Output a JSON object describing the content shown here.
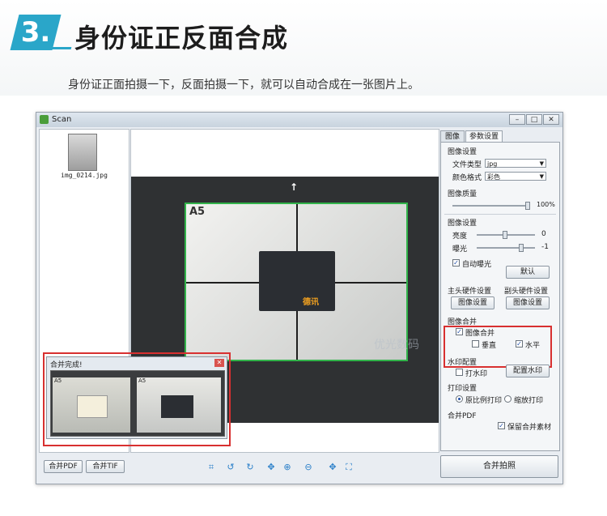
{
  "header": {
    "step_number": "3.",
    "title": "身份证正反面合成",
    "subtitle": "身份证正面拍摄一下，反面拍摄一下，就可以自动合成在一张图片上。"
  },
  "window": {
    "title": "Scan",
    "controls": [
      "–",
      "□",
      "✕"
    ]
  },
  "thumbnail": {
    "filename": "img_0214.jpg"
  },
  "preview": {
    "frame_label": "A5",
    "arrow": "↑",
    "card_logo": "德讯",
    "watermark": "优光数码"
  },
  "popup": {
    "title": "合并完成!",
    "close": "✕",
    "left_label": "A5",
    "right_label": "A5"
  },
  "bottom": {
    "merge_pdf": "合并PDF",
    "merge_tif": "合并TIF",
    "merge_shoot": "合并拍照",
    "tools": [
      "crop-icon",
      "rotate-left-icon",
      "rotate-right-icon",
      "move-icon",
      "zoom-in-icon",
      "zoom-out-icon",
      "pan-icon",
      "fit-icon"
    ]
  },
  "settings": {
    "tabs": [
      "图像",
      "参数设置"
    ],
    "image_settings": "图像设置",
    "file_type_label": "文件类型",
    "file_type_value": "jpg",
    "color_mode_label": "颜色格式",
    "color_mode_value": "彩色",
    "quality_label": "图像质量",
    "quality_value": "100%",
    "quality_level": 1.0,
    "image_settings2": "图像设置",
    "brightness_label": "亮度",
    "brightness_value": "0",
    "exposure_label": "曝光",
    "exposure_value": "-1",
    "auto_exposure_label": "自动曝光",
    "default_button": "默认",
    "main_hw_label": "主头硬件设置",
    "sub_hw_label": "副头硬件设置",
    "main_hw_button": "图像设置",
    "sub_hw_button": "图像设置",
    "merge_section": "图像合并",
    "merge_checkbox": "图像合并",
    "vertical_label": "垂直",
    "horizontal_label": "水平",
    "watermark_section": "水印配置",
    "watermark_checkbox": "打水印",
    "watermark_button": "配置水印",
    "print_section": "打印设置",
    "print_original": "原比例打印",
    "print_scaled": "缩放打印",
    "pdf_section": "合并PDF",
    "keep_material": "保留合并素材"
  }
}
